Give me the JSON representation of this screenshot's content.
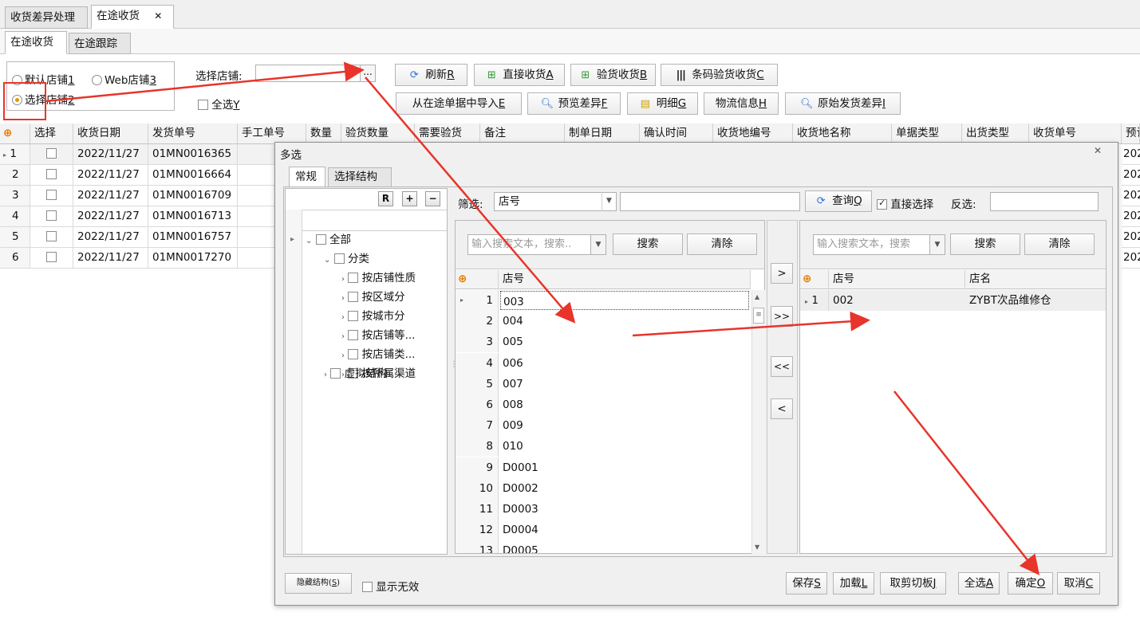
{
  "tabs": {
    "tab1": "收货差异处理",
    "tab2": "在途收货",
    "close": "✕"
  },
  "subtabs": {
    "tab1": "在途收货",
    "tab2": "在途跟踪"
  },
  "store_mode": {
    "opt1_label": "默认店铺",
    "opt1_key": "1",
    "opt2_label": "Web店铺",
    "opt2_key": "3",
    "opt3_label": "选择店铺",
    "opt3_key": "2",
    "selected": "选择店铺2"
  },
  "select_store": {
    "label": "选择店铺:",
    "value": "",
    "ellipsis": "..."
  },
  "select_all": {
    "label": "全选",
    "key": "Y"
  },
  "toolbar": {
    "refresh_label": "刷新",
    "refresh_key": "R",
    "direct_label": "直接收货",
    "direct_key": "A",
    "inspect_label": "验货收货",
    "inspect_key": "B",
    "barcode_label": "条码验货收货",
    "barcode_key": "C",
    "import_label": "从在途单据中导入",
    "import_key": "E",
    "preview_label": "预览差异",
    "preview_key": "F",
    "detail_label": "明细",
    "detail_key": "G",
    "logistics_label": "物流信息",
    "logistics_key": "H",
    "orig_label": "原始发货差异",
    "orig_key": "I"
  },
  "grid": {
    "columns": [
      "选择",
      "收货日期",
      "发货单号",
      "手工单号",
      "数量",
      "验货数量",
      "需要验货",
      "备注",
      "制单日期",
      "确认时间",
      "收货地编号",
      "收货地名称",
      "单据类型",
      "出货类型",
      "收货单号",
      "预计"
    ],
    "rows": [
      {
        "num": "1",
        "checked": false,
        "date": "2022/11/27",
        "doc": "01MN0016365",
        "right": "202"
      },
      {
        "num": "2",
        "checked": false,
        "date": "2022/11/27",
        "doc": "01MN0016664",
        "right": "202"
      },
      {
        "num": "3",
        "checked": false,
        "date": "2022/11/27",
        "doc": "01MN0016709",
        "right": "202"
      },
      {
        "num": "4",
        "checked": false,
        "date": "2022/11/27",
        "doc": "01MN0016713",
        "right": "202"
      },
      {
        "num": "5",
        "checked": false,
        "date": "2022/11/27",
        "doc": "01MN0016757",
        "right": "202"
      },
      {
        "num": "6",
        "checked": false,
        "date": "2022/11/27",
        "doc": "01MN0017270",
        "right": "202"
      }
    ]
  },
  "dialog": {
    "title": "多选",
    "close": "✕",
    "tabs": {
      "tab1": "常规",
      "tab2": "选择结构"
    },
    "tree_tools": {
      "r": "R",
      "plus": "+",
      "minus": "−"
    },
    "tree": {
      "all": "全部",
      "category": "分类",
      "items": [
        "按店铺性质",
        "按区域分",
        "按城市分",
        "按店铺等...",
        "按店铺类...",
        "按所属渠道"
      ],
      "virtual": "虚拟结构"
    },
    "filter": {
      "label": "筛选:",
      "field": "店号",
      "value": "",
      "query_label": "查询",
      "query_key": "Q",
      "direct_select": "直接选择",
      "reverse_label": "反选:",
      "reverse_value": ""
    },
    "left_list": {
      "search_placeholder": "输入搜索文本，搜索..",
      "search_btn": "搜索",
      "clear_btn": "清除",
      "col": "店号",
      "rows": [
        {
          "n": "1",
          "v": "003"
        },
        {
          "n": "2",
          "v": "004"
        },
        {
          "n": "3",
          "v": "005"
        },
        {
          "n": "4",
          "v": "006"
        },
        {
          "n": "5",
          "v": "007"
        },
        {
          "n": "6",
          "v": "008"
        },
        {
          "n": "7",
          "v": "009"
        },
        {
          "n": "8",
          "v": "010"
        },
        {
          "n": "9",
          "v": "D0001"
        },
        {
          "n": "10",
          "v": "D0002"
        },
        {
          "n": "11",
          "v": "D0003"
        },
        {
          "n": "12",
          "v": "D0004"
        },
        {
          "n": "13",
          "v": "D0005"
        }
      ]
    },
    "move": {
      "one_right": ">",
      "all_right": ">>",
      "all_left": "<<",
      "one_left": "<"
    },
    "right_list": {
      "search_placeholder": "输入搜索文本，搜索",
      "search_btn": "搜索",
      "clear_btn": "清除",
      "col1": "店号",
      "col2": "店名",
      "rows": [
        {
          "n": "1",
          "code": "002",
          "name": "ZYBT次品维修仓"
        }
      ]
    },
    "footer": {
      "hide_struct": "隐藏结构",
      "hide_key": "S",
      "show_invalid": "显示无效",
      "save": "保存",
      "save_key": "S",
      "load": "加载",
      "load_key": "L",
      "clipboard": "取剪切板",
      "clipboard_key": "J",
      "select_all": "全选",
      "select_all_key": "A",
      "ok": "确定",
      "ok_key": "O",
      "cancel": "取消",
      "cancel_key": "C"
    }
  },
  "colors": {
    "annotation": "#e8342a",
    "radio_dot": "#e09a00",
    "icon_blue": "#2a6fd6",
    "icon_green": "#2f9c2f"
  },
  "icons": [
    "refresh-icon",
    "grid-icon",
    "barcode-icon",
    "magnifier-icon",
    "document-icon",
    "add-row-icon",
    "chevron-right-icon",
    "chevron-down-icon"
  ]
}
